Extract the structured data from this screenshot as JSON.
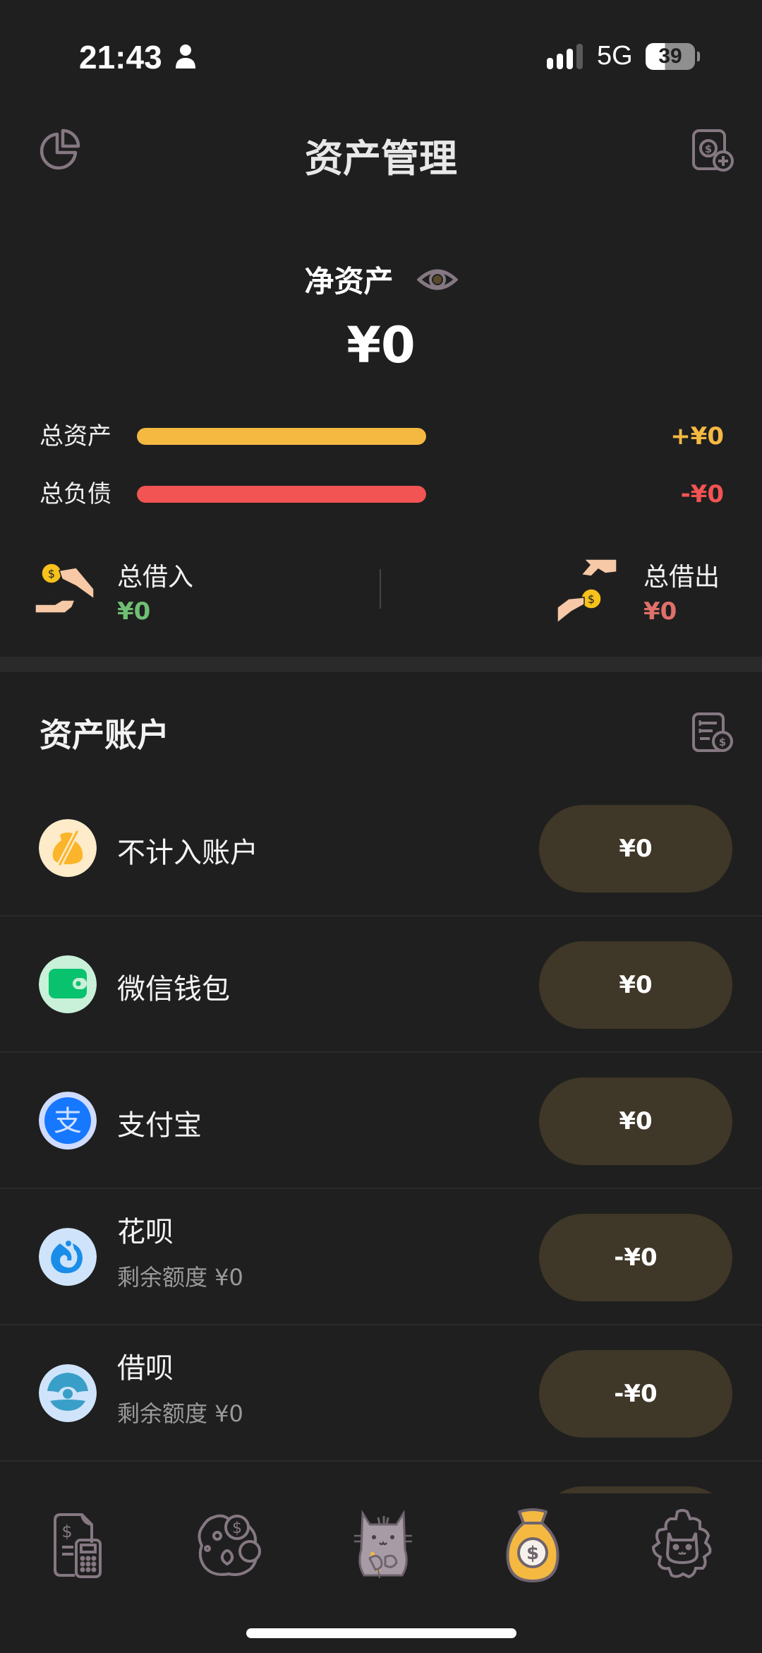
{
  "status_bar": {
    "time": "21:43",
    "network": "5G",
    "battery": "39",
    "battery_level_percent": 39
  },
  "header": {
    "title": "资产管理",
    "left_icon": "pie-chart-icon",
    "right_icon": "add-asset-icon"
  },
  "summary": {
    "net_asset_label": "净资产",
    "net_asset_value": "¥0",
    "total_assets": {
      "label": "总资产",
      "value": "+¥0",
      "color": "#f5b942"
    },
    "total_liabilities": {
      "label": "总负债",
      "value": "-¥0",
      "color": "#f25353"
    },
    "borrowed_in": {
      "label": "总借入",
      "value": "¥0",
      "color": "#6fbf73"
    },
    "lent_out": {
      "label": "总借出",
      "value": "¥0",
      "color": "#e0706a"
    }
  },
  "accounts_section": {
    "title": "资产账户",
    "items": [
      {
        "name": "不计入账户",
        "sub": "",
        "amount": "¥0",
        "icon": "money-bag-excluded-icon"
      },
      {
        "name": "微信钱包",
        "sub": "",
        "amount": "¥0",
        "icon": "wechat-wallet-icon"
      },
      {
        "name": "支付宝",
        "sub": "",
        "amount": "¥0",
        "icon": "alipay-icon"
      },
      {
        "name": "花呗",
        "sub": "剩余额度 ¥0",
        "amount": "-¥0",
        "icon": "huabei-icon"
      },
      {
        "name": "借呗",
        "sub": "剩余额度 ¥0",
        "amount": "-¥0",
        "icon": "jiebei-icon"
      }
    ]
  },
  "tab_bar": {
    "tabs": [
      {
        "id": "bills",
        "icon": "bill-calculator-icon",
        "active": false
      },
      {
        "id": "budget",
        "icon": "paw-coin-icon",
        "active": false
      },
      {
        "id": "record",
        "icon": "cat-mascot-icon",
        "active": false
      },
      {
        "id": "assets",
        "icon": "money-bag-icon",
        "active": true
      },
      {
        "id": "settings",
        "icon": "cat-gear-icon",
        "active": false
      }
    ]
  },
  "colors": {
    "background": "#1f1f1f",
    "pill": "#3f3727",
    "icon_muted": "#8a7f88",
    "accent_gold": "#f5b942"
  }
}
